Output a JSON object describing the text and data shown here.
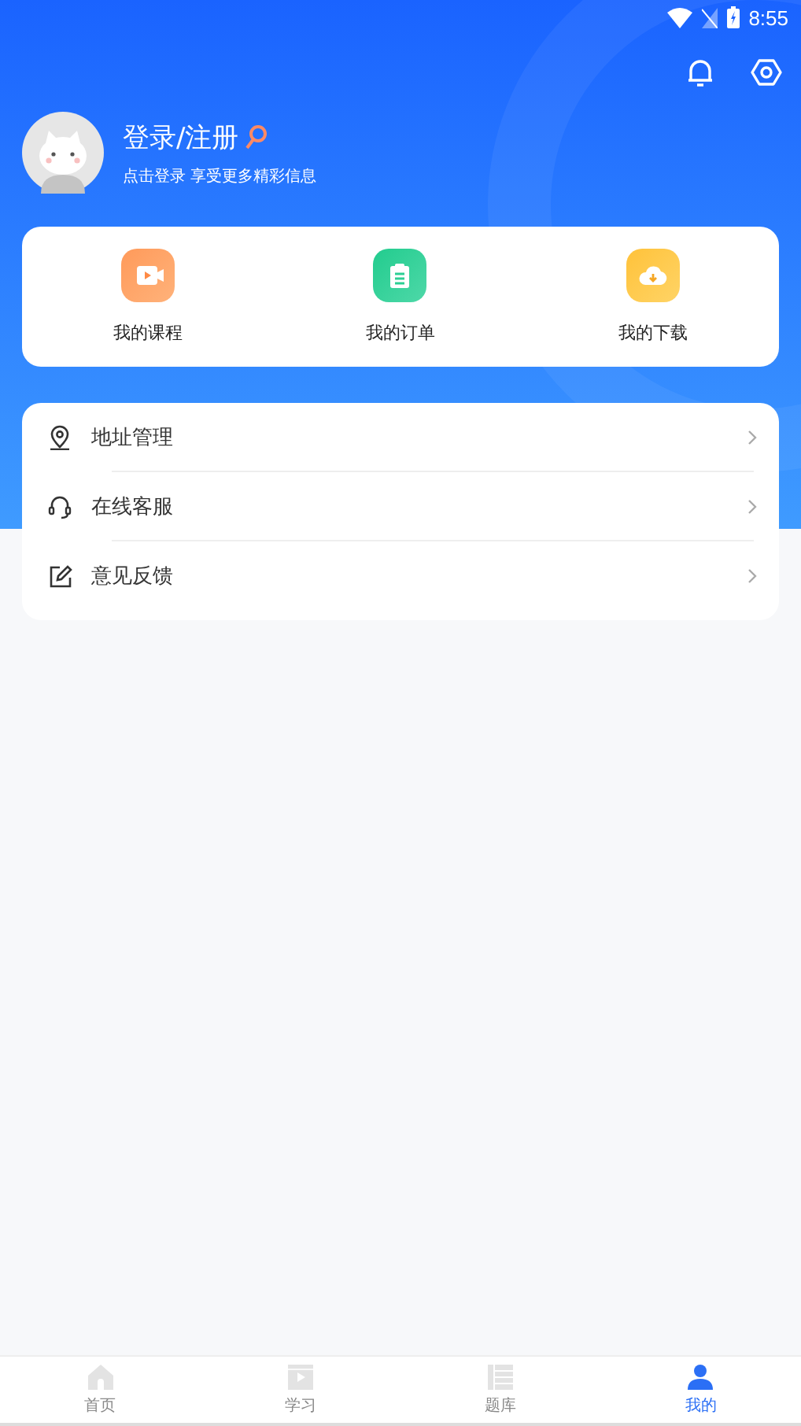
{
  "status_bar": {
    "time": "8:55"
  },
  "profile": {
    "title": "登录/注册",
    "subtitle": "点击登录 享受更多精彩信息"
  },
  "shortcuts": [
    {
      "kind": "video",
      "label": "我的课程"
    },
    {
      "kind": "clipboard",
      "label": "我的订单"
    },
    {
      "kind": "download",
      "label": "我的下载"
    }
  ],
  "menu": [
    {
      "kind": "location",
      "label": "地址管理"
    },
    {
      "kind": "headset",
      "label": "在线客服"
    },
    {
      "kind": "edit",
      "label": "意见反馈"
    }
  ],
  "tabs": [
    {
      "kind": "home",
      "label": "首页",
      "selected": false
    },
    {
      "kind": "video",
      "label": "学习",
      "selected": false
    },
    {
      "kind": "list",
      "label": "题库",
      "selected": false
    },
    {
      "kind": "person",
      "label": "我的",
      "selected": true
    }
  ]
}
